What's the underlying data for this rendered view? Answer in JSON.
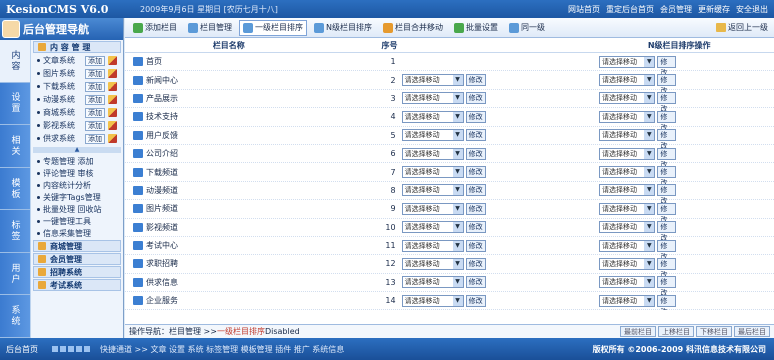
{
  "app": {
    "logo": "KesionCMS V6.0",
    "date": "2009年9月6日 星期日 [农历七月十八]",
    "toplinks": [
      "网站首页",
      "重定后台首页",
      "会员管理",
      "更新缓存",
      "安全退出"
    ]
  },
  "nav": {
    "title": "后台管理导航",
    "vtabs": [
      "内容",
      "设置",
      "相关",
      "模板",
      "标签",
      "用户",
      "系统"
    ],
    "section_title": "内 容 管 理",
    "channel_items": [
      {
        "label": "文章系统",
        "add": "添加"
      },
      {
        "label": "图片系统",
        "add": "添加"
      },
      {
        "label": "下载系统",
        "add": "添加"
      },
      {
        "label": "动漫系统",
        "add": "添加"
      },
      {
        "label": "商城系统",
        "add": "添加"
      },
      {
        "label": "影视系统",
        "add": "添加"
      },
      {
        "label": "供求系统",
        "add": "添加"
      }
    ],
    "plain_items": [
      "专题管理 添加",
      "评论管理 审核",
      "内容统计分析",
      "关键字Tags管理",
      "批量处理 回收站",
      "一键管理工具",
      "信息采集管理"
    ],
    "group_sections": [
      "商城管理",
      "会员管理",
      "招聘系统",
      "考试系统"
    ]
  },
  "toolbar": {
    "buttons": [
      "添加栏目",
      "栏目管理",
      "一级栏目排序",
      "N级栏目排序",
      "栏目合并移动",
      "批量设置",
      "同一级"
    ],
    "right": "返回上一级"
  },
  "table": {
    "headers": {
      "name": "栏目名称",
      "order": "序号",
      "sort": "N级栏目排序操作"
    },
    "select_default": "请选择移动",
    "modify": "修改",
    "rows": [
      {
        "name": "首页",
        "order": "1"
      },
      {
        "name": "新闻中心",
        "order": "2"
      },
      {
        "name": "产品展示",
        "order": "3"
      },
      {
        "name": "技术支持",
        "order": "4"
      },
      {
        "name": "用户反馈",
        "order": "5"
      },
      {
        "name": "公司介绍",
        "order": "6"
      },
      {
        "name": "下载频道",
        "order": "7"
      },
      {
        "name": "动漫频道",
        "order": "8"
      },
      {
        "name": "图片频道",
        "order": "9"
      },
      {
        "name": "影视频道",
        "order": "10"
      },
      {
        "name": "考试中心",
        "order": "11"
      },
      {
        "name": "求职招聘",
        "order": "12"
      },
      {
        "name": "供求信息",
        "order": "13"
      },
      {
        "name": "企业服务",
        "order": "14"
      }
    ]
  },
  "statusbar": {
    "label": "操作导航：",
    "path": "栏目管理 >> ",
    "current": "一级栏目排序",
    "suffix": "Disabled",
    "buttons": [
      "最前栏目",
      "上移栏目",
      "下移栏目",
      "最后栏目"
    ]
  },
  "footer": {
    "home": "后台首页",
    "links": "快捷通道 >> 文章 设置 系统 标签管理 模板管理 插件 推广 系统信息",
    "copy": "版权所有 ©2006-2009 科汛信息技术有限公司"
  }
}
